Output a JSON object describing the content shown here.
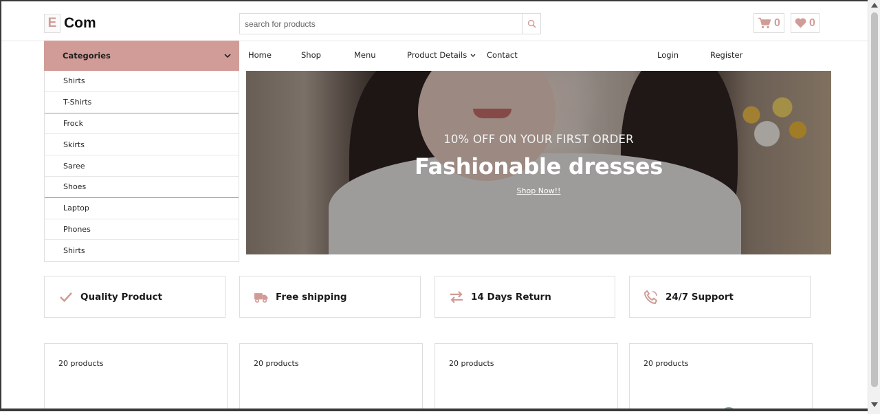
{
  "header": {
    "logo_letter": "E",
    "logo_text": "Com",
    "search_placeholder": "search for products",
    "cart_count": "0",
    "wishlist_count": "0"
  },
  "categories": {
    "title": "Categories",
    "items": [
      "Shirts",
      "T-Shirts",
      "Frock",
      "Skirts",
      "Saree",
      "Shoes",
      "Laptop",
      "Phones",
      "Shirts"
    ]
  },
  "nav": {
    "home": "Home",
    "shop": "Shop",
    "menu": "Menu",
    "product_details": "Product Details",
    "contact": "Contact",
    "login": "Login",
    "register": "Register"
  },
  "hero": {
    "subtitle": "10% OFF ON YOUR FIRST ORDER",
    "title": "Fashionable dresses",
    "cta": "Shop Now!!"
  },
  "features": [
    {
      "label": "Quality Product",
      "icon": "check-icon"
    },
    {
      "label": "Free shipping",
      "icon": "truck-icon"
    },
    {
      "label": "14 Days Return",
      "icon": "exchange-icon"
    },
    {
      "label": "24/7 Support",
      "icon": "phone-icon"
    }
  ],
  "product_cards": [
    {
      "count": "20 products"
    },
    {
      "count": "20 products"
    },
    {
      "count": "20 products"
    },
    {
      "count": "20 products"
    }
  ],
  "colors": {
    "accent": "#d19c97",
    "text": "#1b1b1b",
    "border": "#dedede"
  }
}
